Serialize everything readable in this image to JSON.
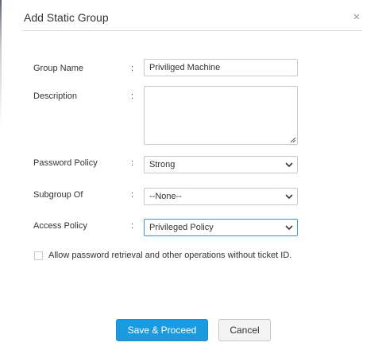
{
  "dialog": {
    "title": "Add Static Group",
    "close_glyph": "×"
  },
  "form": {
    "group_name": {
      "label": "Group Name",
      "colon": ":",
      "value": "Priviliged Machine"
    },
    "description": {
      "label": "Description",
      "colon": ":",
      "value": ""
    },
    "password_policy": {
      "label": "Password Policy",
      "colon": ":",
      "value": "Strong"
    },
    "subgroup_of": {
      "label": "Subgroup Of",
      "colon": ":",
      "value": "--None--"
    },
    "access_policy": {
      "label": "Access Policy",
      "colon": ":",
      "value": "Privileged Policy"
    },
    "allow_retrieval": {
      "label": "Allow password retrieval and other operations without ticket ID.",
      "checked": false
    }
  },
  "buttons": {
    "save_proceed": "Save & Proceed",
    "cancel": "Cancel"
  },
  "colors": {
    "primary": "#1a9be0",
    "focus_border": "#3a8fd8",
    "input_border": "#c9c9c9"
  },
  "icons": {
    "close": "close-icon",
    "select_arrow": "chevron-down-icon",
    "resize": "resize-grip-icon"
  }
}
